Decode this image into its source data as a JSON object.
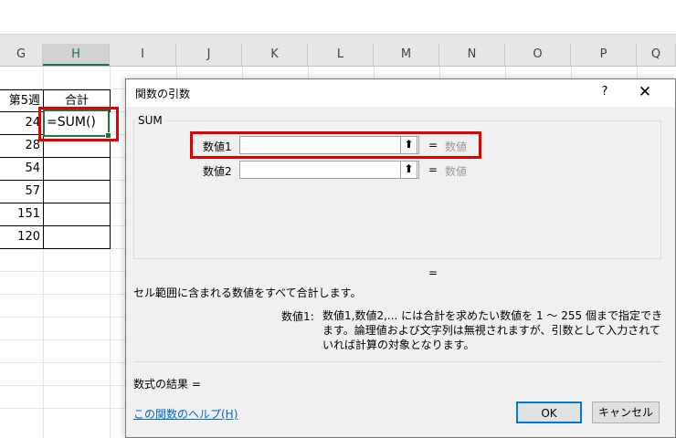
{
  "columns": [
    "G",
    "H",
    "I",
    "J",
    "K",
    "L",
    "M",
    "N",
    "O",
    "P",
    "Q"
  ],
  "selected_column": "H",
  "sheet": {
    "header_g": "第5週",
    "header_h": "合計",
    "g_values": [
      "24",
      "28",
      "54",
      "57",
      "151",
      "120"
    ],
    "active_formula": "=SUM()"
  },
  "dialog": {
    "title": "関数の引数",
    "help_button": "?",
    "close_button": "✕",
    "function_name": "SUM",
    "args": [
      {
        "label": "数値1",
        "equals": "=",
        "value_hint": "数値",
        "ref_button": "⬆"
      },
      {
        "label": "数値2",
        "equals": "=",
        "value_hint": "数値",
        "ref_button": "⬆"
      }
    ],
    "result_equals": "=",
    "description": "セル範囲に含まれる数値をすべて合計します。",
    "arg_desc_label": "数値1:",
    "arg_desc_text": "数値1,数値2,... には合計を求めたい数値を 1 ～ 255 個まで指定できます。論理値および文字列は無視されますが、引数として入力されていれば計算の対象となります。",
    "formula_result": "数式の結果 =",
    "help_link": "この関数のヘルプ(H)",
    "ok": "OK",
    "cancel": "キャンセル"
  },
  "colors": {
    "accent_green": "#217346",
    "highlight_red": "#e00000",
    "link_blue": "#0066cc"
  }
}
